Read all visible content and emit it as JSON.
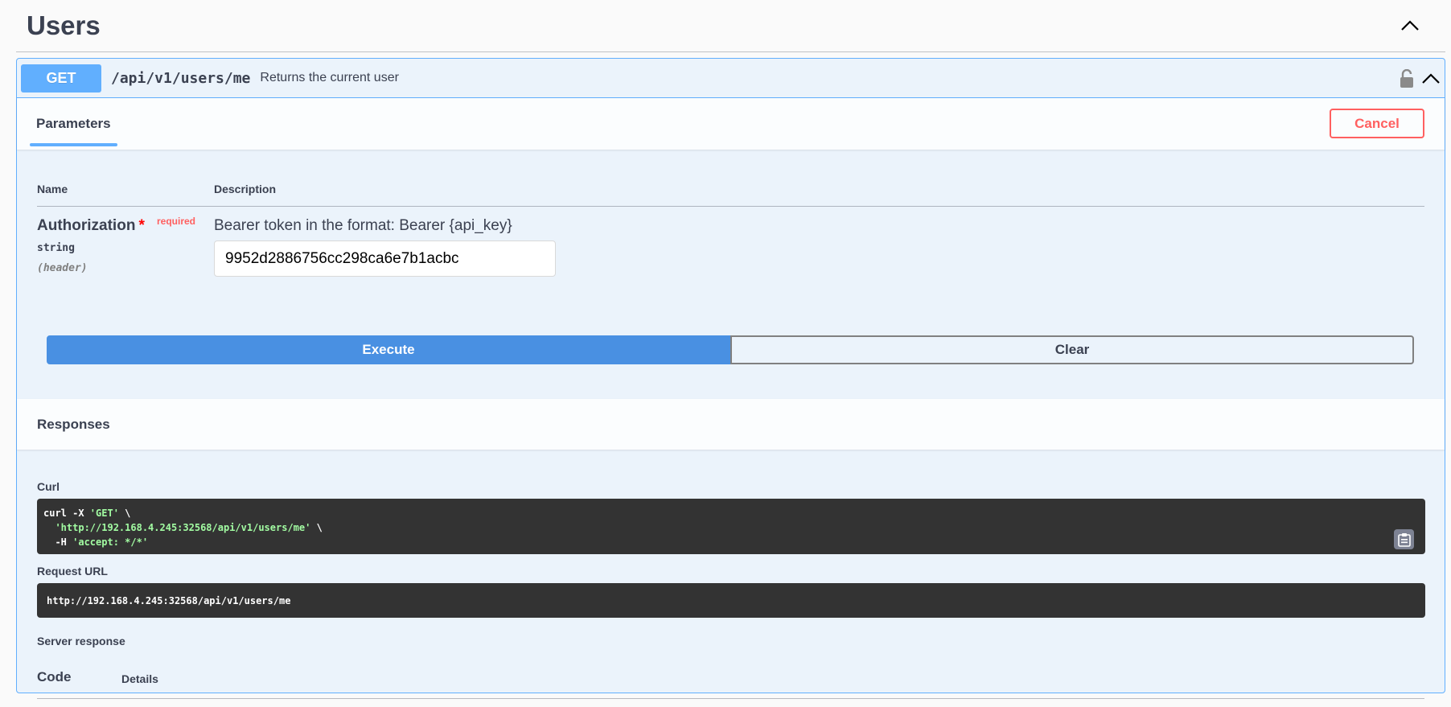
{
  "tag": {
    "title": "Users",
    "toggle_icon": "chevron-up-icon"
  },
  "operation": {
    "method": "GET",
    "path": "/api/v1/users/me",
    "summary": "Returns the current user",
    "lock_icon": "unlocked-padlock-icon",
    "collapse_icon": "chevron-up-icon",
    "method_color": "#61affe"
  },
  "parameters": {
    "tab_label": "Parameters",
    "cancel_label": "Cancel",
    "columns": {
      "name": "Name",
      "description": "Description"
    },
    "items": [
      {
        "name": "Authorization",
        "required_star": "*",
        "required_label": "required",
        "type": "string",
        "location": "(header)",
        "description": "Bearer token in the format: Bearer {api_key}",
        "value": "9952d2886756cc298ca6e7b1acbc"
      }
    ],
    "execute_label": "Execute",
    "clear_label": "Clear"
  },
  "responses": {
    "title": "Responses",
    "curl_label": "Curl",
    "curl_lines": [
      {
        "plain": "curl -X ",
        "str": "'GET'",
        "tail": " \\"
      },
      {
        "plain": "  ",
        "str": "'http://192.168.4.245:32568/api/v1/users/me'",
        "tail": " \\"
      },
      {
        "plain": "  -H ",
        "str": "'accept: */*'",
        "tail": ""
      }
    ],
    "copy_icon": "clipboard-copy-icon",
    "request_url_label": "Request URL",
    "request_url": "http://192.168.4.245:32568/api/v1/users/me",
    "server_response_label": "Server response",
    "table_headers": {
      "code": "Code",
      "details": "Details"
    }
  }
}
